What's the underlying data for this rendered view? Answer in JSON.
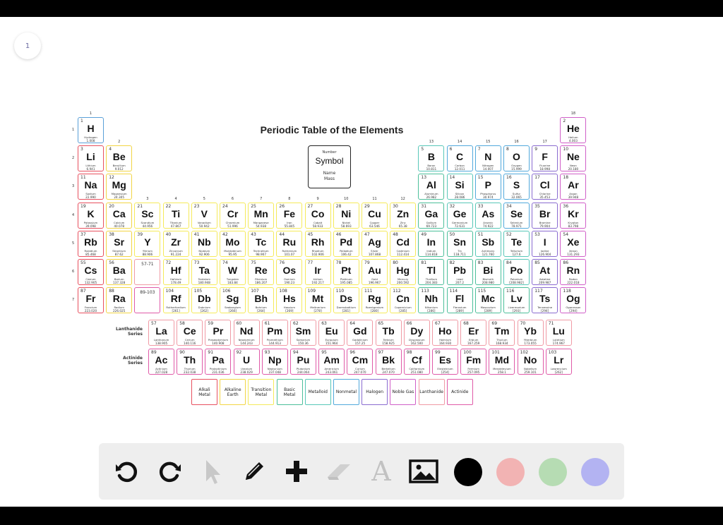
{
  "page_indicator": "1",
  "table": {
    "title": "Periodic Table of the Elements",
    "group_numbers": [
      "1",
      "2",
      "3",
      "4",
      "5",
      "6",
      "7",
      "8",
      "9",
      "10",
      "11",
      "12",
      "13",
      "14",
      "15",
      "16",
      "17",
      "18"
    ],
    "period_numbers": [
      "1",
      "2",
      "3",
      "4",
      "5",
      "6",
      "7"
    ],
    "reference_key": {
      "number": "Number",
      "symbol": "Symbol",
      "name": "Name",
      "mass": "Mass"
    },
    "lanthanide_label": "Lanthanide Series",
    "actinide_label": "Actinide Series",
    "placeholder_57_71": "57-71",
    "placeholder_89_103": "89-103",
    "category_colors": {
      "hydrogen": "#5aa0d8",
      "alkali": "#e8505f",
      "alkaline": "#f2d544",
      "transition": "#f5ea5a",
      "basic": "#4cbf9a",
      "metalloid": "#58c7b8",
      "nonmetal": "#52a9dc",
      "halogen": "#8a6bd0",
      "noble": "#d05fc8",
      "lanthanide": "#f09aa5",
      "actinide": "#e05aa8"
    },
    "elements": [
      {
        "n": "1",
        "s": "H",
        "name": "Hydrogen",
        "m": "1.008",
        "c": "hydrogen"
      },
      {
        "n": "2",
        "s": "He",
        "name": "Helium",
        "m": "4.003",
        "c": "noble"
      },
      {
        "n": "3",
        "s": "Li",
        "name": "Lithium",
        "m": "6.941",
        "c": "alkali"
      },
      {
        "n": "4",
        "s": "Be",
        "name": "Beryllium",
        "m": "9.012",
        "c": "alkaline"
      },
      {
        "n": "5",
        "s": "B",
        "name": "Boron",
        "m": "10.811",
        "c": "metalloid"
      },
      {
        "n": "6",
        "s": "C",
        "name": "Carbon",
        "m": "12.011",
        "c": "nonmetal"
      },
      {
        "n": "7",
        "s": "N",
        "name": "Nitrogen",
        "m": "14.007",
        "c": "nonmetal"
      },
      {
        "n": "8",
        "s": "O",
        "name": "Oxygen",
        "m": "15.999",
        "c": "nonmetal"
      },
      {
        "n": "9",
        "s": "F",
        "name": "Fluorine",
        "m": "18.998",
        "c": "halogen"
      },
      {
        "n": "10",
        "s": "Ne",
        "name": "Neon",
        "m": "20.180",
        "c": "noble"
      },
      {
        "n": "11",
        "s": "Na",
        "name": "Sodium",
        "m": "22.990",
        "c": "alkali"
      },
      {
        "n": "12",
        "s": "Mg",
        "name": "Magnesium",
        "m": "24.305",
        "c": "alkaline"
      },
      {
        "n": "13",
        "s": "Al",
        "name": "Aluminum",
        "m": "26.982",
        "c": "basic"
      },
      {
        "n": "14",
        "s": "Si",
        "name": "Silicon",
        "m": "28.086",
        "c": "metalloid"
      },
      {
        "n": "15",
        "s": "P",
        "name": "Phosphorus",
        "m": "30.974",
        "c": "nonmetal"
      },
      {
        "n": "16",
        "s": "S",
        "name": "Sulfur",
        "m": "32.065",
        "c": "nonmetal"
      },
      {
        "n": "17",
        "s": "Cl",
        "name": "Chlorine",
        "m": "35.453",
        "c": "halogen"
      },
      {
        "n": "18",
        "s": "Ar",
        "name": "Argon",
        "m": "39.948",
        "c": "noble"
      },
      {
        "n": "19",
        "s": "K",
        "name": "Potassium",
        "m": "39.098",
        "c": "alkali"
      },
      {
        "n": "20",
        "s": "Ca",
        "name": "Calcium",
        "m": "40.078",
        "c": "alkaline"
      },
      {
        "n": "21",
        "s": "Sc",
        "name": "Scandium",
        "m": "44.956",
        "c": "transition"
      },
      {
        "n": "22",
        "s": "Ti",
        "name": "Titanium",
        "m": "47.867",
        "c": "transition"
      },
      {
        "n": "23",
        "s": "V",
        "name": "Vanadium",
        "m": "50.942",
        "c": "transition"
      },
      {
        "n": "24",
        "s": "Cr",
        "name": "Chromium",
        "m": "51.996",
        "c": "transition"
      },
      {
        "n": "25",
        "s": "Mn",
        "name": "Manganese",
        "m": "54.938",
        "c": "transition"
      },
      {
        "n": "26",
        "s": "Fe",
        "name": "Iron",
        "m": "55.845",
        "c": "transition"
      },
      {
        "n": "27",
        "s": "Co",
        "name": "Cobalt",
        "m": "58.933",
        "c": "transition"
      },
      {
        "n": "28",
        "s": "Ni",
        "name": "Nickel",
        "m": "58.693",
        "c": "transition"
      },
      {
        "n": "29",
        "s": "Cu",
        "name": "Copper",
        "m": "63.546",
        "c": "transition"
      },
      {
        "n": "30",
        "s": "Zn",
        "name": "Zinc",
        "m": "65.38",
        "c": "transition"
      },
      {
        "n": "31",
        "s": "Ga",
        "name": "Gallium",
        "m": "69.723",
        "c": "basic"
      },
      {
        "n": "32",
        "s": "Ge",
        "name": "Germanium",
        "m": "72.631",
        "c": "metalloid"
      },
      {
        "n": "33",
        "s": "As",
        "name": "Arsenic",
        "m": "74.922",
        "c": "metalloid"
      },
      {
        "n": "34",
        "s": "Se",
        "name": "Selenium",
        "m": "78.971",
        "c": "nonmetal"
      },
      {
        "n": "35",
        "s": "Br",
        "name": "Bromine",
        "m": "79.904",
        "c": "halogen"
      },
      {
        "n": "36",
        "s": "Kr",
        "name": "Krypton",
        "m": "83.798",
        "c": "noble"
      },
      {
        "n": "37",
        "s": "Rb",
        "name": "Rubidium",
        "m": "85.468",
        "c": "alkali"
      },
      {
        "n": "38",
        "s": "Sr",
        "name": "Strontium",
        "m": "87.62",
        "c": "alkaline"
      },
      {
        "n": "39",
        "s": "Y",
        "name": "Yttrium",
        "m": "88.906",
        "c": "transition"
      },
      {
        "n": "40",
        "s": "Zr",
        "name": "Zirconium",
        "m": "91.224",
        "c": "transition"
      },
      {
        "n": "41",
        "s": "Nb",
        "name": "Niobium",
        "m": "92.906",
        "c": "transition"
      },
      {
        "n": "42",
        "s": "Mo",
        "name": "Molybdenum",
        "m": "95.95",
        "c": "transition"
      },
      {
        "n": "43",
        "s": "Tc",
        "name": "Technetium",
        "m": "98.907",
        "c": "transition"
      },
      {
        "n": "44",
        "s": "Ru",
        "name": "Ruthenium",
        "m": "101.07",
        "c": "transition"
      },
      {
        "n": "45",
        "s": "Rh",
        "name": "Rhodium",
        "m": "102.906",
        "c": "transition"
      },
      {
        "n": "46",
        "s": "Pd",
        "name": "Palladium",
        "m": "106.42",
        "c": "transition"
      },
      {
        "n": "47",
        "s": "Ag",
        "name": "Silver",
        "m": "107.868",
        "c": "transition"
      },
      {
        "n": "48",
        "s": "Cd",
        "name": "Cadmium",
        "m": "112.414",
        "c": "transition"
      },
      {
        "n": "49",
        "s": "In",
        "name": "Indium",
        "m": "114.818",
        "c": "basic"
      },
      {
        "n": "50",
        "s": "Sn",
        "name": "Tin",
        "m": "118.711",
        "c": "basic"
      },
      {
        "n": "51",
        "s": "Sb",
        "name": "Antimony",
        "m": "121.760",
        "c": "metalloid"
      },
      {
        "n": "52",
        "s": "Te",
        "name": "Tellurium",
        "m": "127.6",
        "c": "metalloid"
      },
      {
        "n": "53",
        "s": "I",
        "name": "Iodine",
        "m": "126.904",
        "c": "halogen"
      },
      {
        "n": "54",
        "s": "Xe",
        "name": "Xenon",
        "m": "131.293",
        "c": "noble"
      },
      {
        "n": "55",
        "s": "Cs",
        "name": "Cesium",
        "m": "132.905",
        "c": "alkali"
      },
      {
        "n": "56",
        "s": "Ba",
        "name": "Barium",
        "m": "137.328",
        "c": "alkaline"
      },
      {
        "n": "72",
        "s": "Hf",
        "name": "Hafnium",
        "m": "178.49",
        "c": "transition"
      },
      {
        "n": "73",
        "s": "Ta",
        "name": "Tantalum",
        "m": "180.948",
        "c": "transition"
      },
      {
        "n": "74",
        "s": "W",
        "name": "Tungsten",
        "m": "183.84",
        "c": "transition"
      },
      {
        "n": "75",
        "s": "Re",
        "name": "Rhenium",
        "m": "186.207",
        "c": "transition"
      },
      {
        "n": "76",
        "s": "Os",
        "name": "Osmium",
        "m": "190.23",
        "c": "transition"
      },
      {
        "n": "77",
        "s": "Ir",
        "name": "Iridium",
        "m": "192.217",
        "c": "transition"
      },
      {
        "n": "78",
        "s": "Pt",
        "name": "Platinum",
        "m": "195.085",
        "c": "transition"
      },
      {
        "n": "79",
        "s": "Au",
        "name": "Gold",
        "m": "196.967",
        "c": "transition"
      },
      {
        "n": "80",
        "s": "Hg",
        "name": "Mercury",
        "m": "200.592",
        "c": "transition"
      },
      {
        "n": "81",
        "s": "Tl",
        "name": "Thallium",
        "m": "204.383",
        "c": "basic"
      },
      {
        "n": "82",
        "s": "Pb",
        "name": "Lead",
        "m": "207.2",
        "c": "basic"
      },
      {
        "n": "83",
        "s": "Bi",
        "name": "Bismuth",
        "m": "208.980",
        "c": "basic"
      },
      {
        "n": "84",
        "s": "Po",
        "name": "Polonium",
        "m": "[208.982]",
        "c": "metalloid"
      },
      {
        "n": "85",
        "s": "At",
        "name": "Astatine",
        "m": "209.987",
        "c": "halogen"
      },
      {
        "n": "86",
        "s": "Rn",
        "name": "Radon",
        "m": "222.018",
        "c": "noble"
      },
      {
        "n": "87",
        "s": "Fr",
        "name": "Francium",
        "m": "223.020",
        "c": "alkali"
      },
      {
        "n": "88",
        "s": "Ra",
        "name": "Radium",
        "m": "226.025",
        "c": "alkaline"
      },
      {
        "n": "104",
        "s": "Rf",
        "name": "Rutherfordium",
        "m": "[261]",
        "c": "transition"
      },
      {
        "n": "105",
        "s": "Db",
        "name": "Dubnium",
        "m": "[262]",
        "c": "transition"
      },
      {
        "n": "106",
        "s": "Sg",
        "name": "Seaborgium",
        "m": "[266]",
        "c": "transition"
      },
      {
        "n": "107",
        "s": "Bh",
        "name": "Bohrium",
        "m": "[264]",
        "c": "transition"
      },
      {
        "n": "108",
        "s": "Hs",
        "name": "Hassium",
        "m": "[269]",
        "c": "transition"
      },
      {
        "n": "109",
        "s": "Mt",
        "name": "Meitnerium",
        "m": "[278]",
        "c": "transition"
      },
      {
        "n": "110",
        "s": "Ds",
        "name": "Darmstadtium",
        "m": "[281]",
        "c": "transition"
      },
      {
        "n": "111",
        "s": "Rg",
        "name": "Roentgenium",
        "m": "[280]",
        "c": "transition"
      },
      {
        "n": "112",
        "s": "Cn",
        "name": "Copernicium",
        "m": "[285]",
        "c": "transition"
      },
      {
        "n": "113",
        "s": "Nh",
        "name": "Nihonium",
        "m": "[286]",
        "c": "basic"
      },
      {
        "n": "114",
        "s": "Fl",
        "name": "Flerovium",
        "m": "[289]",
        "c": "basic"
      },
      {
        "n": "115",
        "s": "Mc",
        "name": "Moscovium",
        "m": "[289]",
        "c": "basic"
      },
      {
        "n": "116",
        "s": "Lv",
        "name": "Livermorium",
        "m": "[293]",
        "c": "basic"
      },
      {
        "n": "117",
        "s": "Ts",
        "name": "Tennessine",
        "m": "[294]",
        "c": "halogen"
      },
      {
        "n": "118",
        "s": "Og",
        "name": "Oganesson",
        "m": "[294]",
        "c": "noble"
      }
    ],
    "lanthanides": [
      {
        "n": "57",
        "s": "La",
        "name": "Lanthanum",
        "m": "138.905"
      },
      {
        "n": "58",
        "s": "Ce",
        "name": "Cerium",
        "m": "140.116"
      },
      {
        "n": "59",
        "s": "Pr",
        "name": "Praseodymium",
        "m": "140.908"
      },
      {
        "n": "60",
        "s": "Nd",
        "name": "Neodymium",
        "m": "144.243"
      },
      {
        "n": "61",
        "s": "Pm",
        "name": "Promethium",
        "m": "144.913"
      },
      {
        "n": "62",
        "s": "Sm",
        "name": "Samarium",
        "m": "150.36"
      },
      {
        "n": "63",
        "s": "Eu",
        "name": "Europium",
        "m": "151.964"
      },
      {
        "n": "64",
        "s": "Gd",
        "name": "Gadolinium",
        "m": "157.25"
      },
      {
        "n": "65",
        "s": "Tb",
        "name": "Terbium",
        "m": "158.925"
      },
      {
        "n": "66",
        "s": "Dy",
        "name": "Dysprosium",
        "m": "162.500"
      },
      {
        "n": "67",
        "s": "Ho",
        "name": "Holmium",
        "m": "164.930"
      },
      {
        "n": "68",
        "s": "Er",
        "name": "Erbium",
        "m": "167.259"
      },
      {
        "n": "69",
        "s": "Tm",
        "name": "Thulium",
        "m": "168.934"
      },
      {
        "n": "70",
        "s": "Yb",
        "name": "Ytterbium",
        "m": "173.055"
      },
      {
        "n": "71",
        "s": "Lu",
        "name": "Lutetium",
        "m": "174.967"
      }
    ],
    "actinides": [
      {
        "n": "89",
        "s": "Ac",
        "name": "Actinium",
        "m": "227.028"
      },
      {
        "n": "90",
        "s": "Th",
        "name": "Thorium",
        "m": "232.038"
      },
      {
        "n": "91",
        "s": "Pa",
        "name": "Protactinium",
        "m": "231.036"
      },
      {
        "n": "92",
        "s": "U",
        "name": "Uranium",
        "m": "238.029"
      },
      {
        "n": "93",
        "s": "Np",
        "name": "Neptunium",
        "m": "237.048"
      },
      {
        "n": "94",
        "s": "Pu",
        "name": "Plutonium",
        "m": "244.064"
      },
      {
        "n": "95",
        "s": "Am",
        "name": "Americium",
        "m": "243.061"
      },
      {
        "n": "96",
        "s": "Cm",
        "name": "Curium",
        "m": "247.070"
      },
      {
        "n": "97",
        "s": "Bk",
        "name": "Berkelium",
        "m": "247.070"
      },
      {
        "n": "98",
        "s": "Cf",
        "name": "Californium",
        "m": "251.080"
      },
      {
        "n": "99",
        "s": "Es",
        "name": "Einsteinium",
        "m": "[254]"
      },
      {
        "n": "100",
        "s": "Fm",
        "name": "Fermium",
        "m": "257.095"
      },
      {
        "n": "101",
        "s": "Md",
        "name": "Mendelevium",
        "m": "258.1"
      },
      {
        "n": "102",
        "s": "No",
        "name": "Nobelium",
        "m": "259.101"
      },
      {
        "n": "103",
        "s": "Lr",
        "name": "Lawrencium",
        "m": "[262]"
      }
    ],
    "legend": [
      {
        "label": "Alkali Metal",
        "c": "alkali"
      },
      {
        "label": "Alkaline Earth",
        "c": "alkaline"
      },
      {
        "label": "Transition Metal",
        "c": "transition"
      },
      {
        "label": "Basic Metal",
        "c": "basic"
      },
      {
        "label": "Metalloid",
        "c": "metalloid"
      },
      {
        "label": "Nonmetal",
        "c": "nonmetal"
      },
      {
        "label": "Halogen",
        "c": "halogen"
      },
      {
        "label": "Noble Gas",
        "c": "noble"
      },
      {
        "label": "Lanthanide",
        "c": "lanthanide"
      },
      {
        "label": "Actinide",
        "c": "actinide"
      }
    ]
  },
  "toolbar": {
    "tools": [
      {
        "id": "undo",
        "icon": "undo-icon",
        "enabled": true
      },
      {
        "id": "redo",
        "icon": "redo-icon",
        "enabled": true
      },
      {
        "id": "select",
        "icon": "pointer-icon",
        "enabled": false
      },
      {
        "id": "pen",
        "icon": "pencil-icon",
        "enabled": true
      },
      {
        "id": "add",
        "icon": "plus-icon",
        "enabled": true
      },
      {
        "id": "eraser",
        "icon": "eraser-icon",
        "enabled": false
      },
      {
        "id": "text",
        "icon": "text-icon",
        "glyph": "A",
        "enabled": false
      },
      {
        "id": "image",
        "icon": "image-icon",
        "enabled": true
      }
    ],
    "colors": [
      "#000000",
      "#f2b3b3",
      "#b6dcb3",
      "#b3b3f2"
    ]
  }
}
